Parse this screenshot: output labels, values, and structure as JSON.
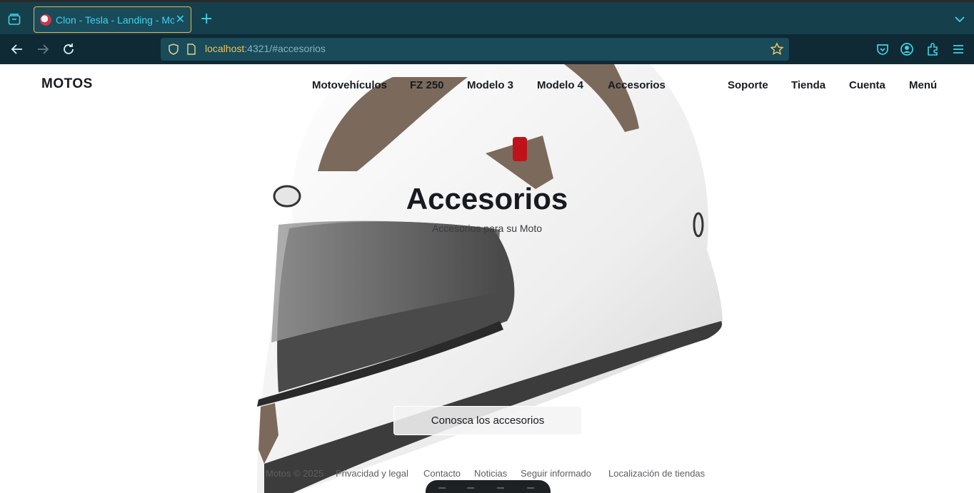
{
  "browser": {
    "tab": {
      "title": "Clon - Tesla - Landing - Motos",
      "close": "✕"
    },
    "new_tab": "+",
    "url": {
      "host": "localhost",
      "rest": ":4321/#accesorios"
    },
    "colors": {
      "chrome": "#163f4c",
      "toolbar": "#0f2a34",
      "accent": "#3fd3e8",
      "highlight": "#f0c15d"
    }
  },
  "site": {
    "logo": "MOTOS",
    "nav": [
      {
        "label": "Motovehículos"
      },
      {
        "label": "FZ 250"
      },
      {
        "label": "Modelo 3"
      },
      {
        "label": "Modelo 4"
      },
      {
        "label": "Accesorios"
      }
    ],
    "nav_right": [
      {
        "label": "Soporte"
      },
      {
        "label": "Tienda"
      },
      {
        "label": "Cuenta"
      },
      {
        "label": "Menú"
      }
    ]
  },
  "hero": {
    "title": "Accesorios",
    "subtitle": "Accesorios para su Moto",
    "cta": "Conosca los accesorios"
  },
  "footer": {
    "items": [
      {
        "label": "Motos © 2025"
      },
      {
        "label": "Privacidad y legal"
      },
      {
        "label": "Contacto"
      },
      {
        "label": "Noticias"
      },
      {
        "label": "Seguir informado"
      },
      {
        "label": "Localización de tiendas"
      }
    ]
  }
}
